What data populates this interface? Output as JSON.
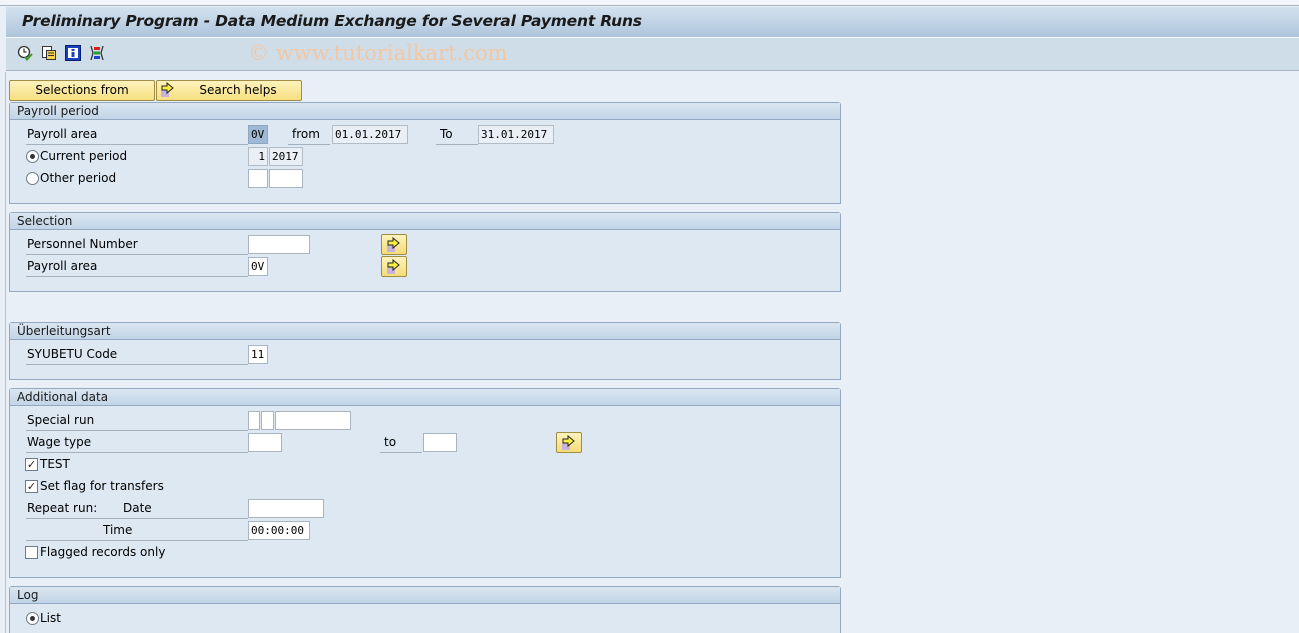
{
  "window": {
    "title": "Preliminary Program - Data Medium Exchange for Several Payment Runs",
    "watermark": "© www.tutorialkart.com"
  },
  "toolbar": {
    "icons": [
      "execute-clock-icon",
      "get-variant-icon",
      "info-icon",
      "selection-options-icon"
    ]
  },
  "buttons": {
    "selections_from": "Selections from",
    "search_helps": "Search helps"
  },
  "payroll_period": {
    "title": "Payroll period",
    "payroll_area_label": "Payroll area",
    "payroll_area_value": "0V",
    "from_label": "from",
    "from_value": "01.01.2017",
    "to_label": "To",
    "to_value": "31.01.2017",
    "current_period_label": "Current period",
    "current_period_selected": true,
    "current_period_number": "1",
    "current_period_year": "2017",
    "other_period_label": "Other period",
    "other_period_selected": false,
    "other_period_number": "",
    "other_period_year": ""
  },
  "selection": {
    "title": "Selection",
    "personnel_number_label": "Personnel Number",
    "personnel_number_value": "",
    "payroll_area_label": "Payroll area",
    "payroll_area_value": "0V"
  },
  "ueberleitungsart": {
    "title": "Überleitungsart",
    "syubetu_label": "SYUBETU Code",
    "syubetu_value": "11"
  },
  "additional_data": {
    "title": "Additional data",
    "special_run_label": "Special run",
    "special_run_values": [
      "",
      "",
      ""
    ],
    "wage_type_label": "Wage type",
    "wage_type_from": "",
    "wage_type_to_label": "to",
    "wage_type_to": "",
    "test_label": "TEST",
    "test_checked": true,
    "set_flag_label": "Set flag for transfers",
    "set_flag_checked": true,
    "repeat_run_label": "Repeat run:",
    "date_label": "Date",
    "date_value": "",
    "time_label": "Time",
    "time_value": "00:00:00",
    "flagged_only_label": "Flagged records only",
    "flagged_only_checked": false
  },
  "log": {
    "title": "Log",
    "list_label": "List",
    "list_selected": true
  },
  "colors": {
    "button_yellow": "#f6df7f",
    "group_background": "#dde8f2",
    "header_blue": "#c1d4e6",
    "watermark": "#f2c7a4"
  }
}
